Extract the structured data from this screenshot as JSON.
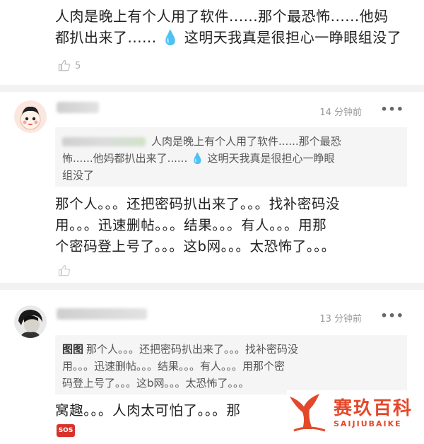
{
  "top_comment": {
    "text_line1": "人肉是晚上有个人用了软件......那个最恐怖......他妈",
    "text_line2a": "都扒出来了......",
    "text_line2b": "这明天我真是很担心一睁眼组没了",
    "like_count": "5"
  },
  "comments": [
    {
      "time": "14 分钟前",
      "more": "•••",
      "quote_line1a": "人肉是晚上有个人用了软件......那个最恐",
      "quote_line2a": "怖......他妈都扒出来了......",
      "quote_line2b": "这明天我真是很担心一睁眼",
      "quote_line3": "组没了",
      "body_line1": "那个人。。。还把密码扒出来了。。。找补密码没",
      "body_line2": "用。。。迅速删帖。。。结果。。。有人。。。用那",
      "body_line3": "个密码登上号了。。。这b网。。。太恐怖了。。。"
    },
    {
      "time": "13 分钟前",
      "more": "•••",
      "quote_name": "图图",
      "quote_line1": "那个人。。。还把密码扒出来了。。。找补密码没",
      "quote_line2": "用。。。迅速删帖。。。结果。。。有人。。。用那个密",
      "quote_line3": "码登上号了。。。这b网。。。太恐怖了。。。",
      "body_line1": "窝趣。。。人肉太可怕了。。。那",
      "badge": "SOS"
    }
  ],
  "watermark": {
    "title": "赛玖百科",
    "subtitle": "SAIJIUBAIKE"
  },
  "colors": {
    "accent": "#e4482a",
    "drop": "#3b8fd6",
    "badge": "#d9322a"
  }
}
